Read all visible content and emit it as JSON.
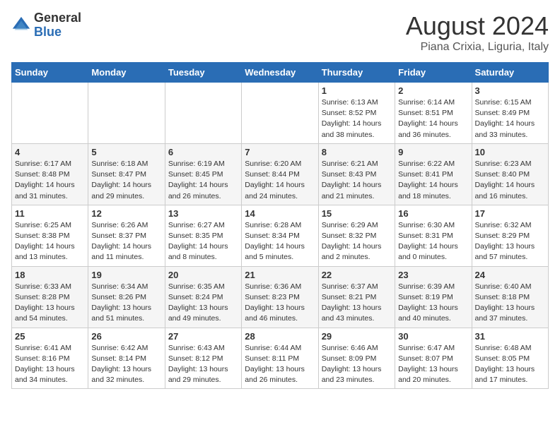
{
  "logo": {
    "general": "General",
    "blue": "Blue"
  },
  "title": "August 2024",
  "subtitle": "Piana Crixia, Liguria, Italy",
  "headers": [
    "Sunday",
    "Monday",
    "Tuesday",
    "Wednesday",
    "Thursday",
    "Friday",
    "Saturday"
  ],
  "weeks": [
    [
      {
        "day": "",
        "info": ""
      },
      {
        "day": "",
        "info": ""
      },
      {
        "day": "",
        "info": ""
      },
      {
        "day": "",
        "info": ""
      },
      {
        "day": "1",
        "info": "Sunrise: 6:13 AM\nSunset: 8:52 PM\nDaylight: 14 hours and 38 minutes."
      },
      {
        "day": "2",
        "info": "Sunrise: 6:14 AM\nSunset: 8:51 PM\nDaylight: 14 hours and 36 minutes."
      },
      {
        "day": "3",
        "info": "Sunrise: 6:15 AM\nSunset: 8:49 PM\nDaylight: 14 hours and 33 minutes."
      }
    ],
    [
      {
        "day": "4",
        "info": "Sunrise: 6:17 AM\nSunset: 8:48 PM\nDaylight: 14 hours and 31 minutes."
      },
      {
        "day": "5",
        "info": "Sunrise: 6:18 AM\nSunset: 8:47 PM\nDaylight: 14 hours and 29 minutes."
      },
      {
        "day": "6",
        "info": "Sunrise: 6:19 AM\nSunset: 8:45 PM\nDaylight: 14 hours and 26 minutes."
      },
      {
        "day": "7",
        "info": "Sunrise: 6:20 AM\nSunset: 8:44 PM\nDaylight: 14 hours and 24 minutes."
      },
      {
        "day": "8",
        "info": "Sunrise: 6:21 AM\nSunset: 8:43 PM\nDaylight: 14 hours and 21 minutes."
      },
      {
        "day": "9",
        "info": "Sunrise: 6:22 AM\nSunset: 8:41 PM\nDaylight: 14 hours and 18 minutes."
      },
      {
        "day": "10",
        "info": "Sunrise: 6:23 AM\nSunset: 8:40 PM\nDaylight: 14 hours and 16 minutes."
      }
    ],
    [
      {
        "day": "11",
        "info": "Sunrise: 6:25 AM\nSunset: 8:38 PM\nDaylight: 14 hours and 13 minutes."
      },
      {
        "day": "12",
        "info": "Sunrise: 6:26 AM\nSunset: 8:37 PM\nDaylight: 14 hours and 11 minutes."
      },
      {
        "day": "13",
        "info": "Sunrise: 6:27 AM\nSunset: 8:35 PM\nDaylight: 14 hours and 8 minutes."
      },
      {
        "day": "14",
        "info": "Sunrise: 6:28 AM\nSunset: 8:34 PM\nDaylight: 14 hours and 5 minutes."
      },
      {
        "day": "15",
        "info": "Sunrise: 6:29 AM\nSunset: 8:32 PM\nDaylight: 14 hours and 2 minutes."
      },
      {
        "day": "16",
        "info": "Sunrise: 6:30 AM\nSunset: 8:31 PM\nDaylight: 14 hours and 0 minutes."
      },
      {
        "day": "17",
        "info": "Sunrise: 6:32 AM\nSunset: 8:29 PM\nDaylight: 13 hours and 57 minutes."
      }
    ],
    [
      {
        "day": "18",
        "info": "Sunrise: 6:33 AM\nSunset: 8:28 PM\nDaylight: 13 hours and 54 minutes."
      },
      {
        "day": "19",
        "info": "Sunrise: 6:34 AM\nSunset: 8:26 PM\nDaylight: 13 hours and 51 minutes."
      },
      {
        "day": "20",
        "info": "Sunrise: 6:35 AM\nSunset: 8:24 PM\nDaylight: 13 hours and 49 minutes."
      },
      {
        "day": "21",
        "info": "Sunrise: 6:36 AM\nSunset: 8:23 PM\nDaylight: 13 hours and 46 minutes."
      },
      {
        "day": "22",
        "info": "Sunrise: 6:37 AM\nSunset: 8:21 PM\nDaylight: 13 hours and 43 minutes."
      },
      {
        "day": "23",
        "info": "Sunrise: 6:39 AM\nSunset: 8:19 PM\nDaylight: 13 hours and 40 minutes."
      },
      {
        "day": "24",
        "info": "Sunrise: 6:40 AM\nSunset: 8:18 PM\nDaylight: 13 hours and 37 minutes."
      }
    ],
    [
      {
        "day": "25",
        "info": "Sunrise: 6:41 AM\nSunset: 8:16 PM\nDaylight: 13 hours and 34 minutes."
      },
      {
        "day": "26",
        "info": "Sunrise: 6:42 AM\nSunset: 8:14 PM\nDaylight: 13 hours and 32 minutes."
      },
      {
        "day": "27",
        "info": "Sunrise: 6:43 AM\nSunset: 8:12 PM\nDaylight: 13 hours and 29 minutes."
      },
      {
        "day": "28",
        "info": "Sunrise: 6:44 AM\nSunset: 8:11 PM\nDaylight: 13 hours and 26 minutes."
      },
      {
        "day": "29",
        "info": "Sunrise: 6:46 AM\nSunset: 8:09 PM\nDaylight: 13 hours and 23 minutes."
      },
      {
        "day": "30",
        "info": "Sunrise: 6:47 AM\nSunset: 8:07 PM\nDaylight: 13 hours and 20 minutes."
      },
      {
        "day": "31",
        "info": "Sunrise: 6:48 AM\nSunset: 8:05 PM\nDaylight: 13 hours and 17 minutes."
      }
    ]
  ]
}
